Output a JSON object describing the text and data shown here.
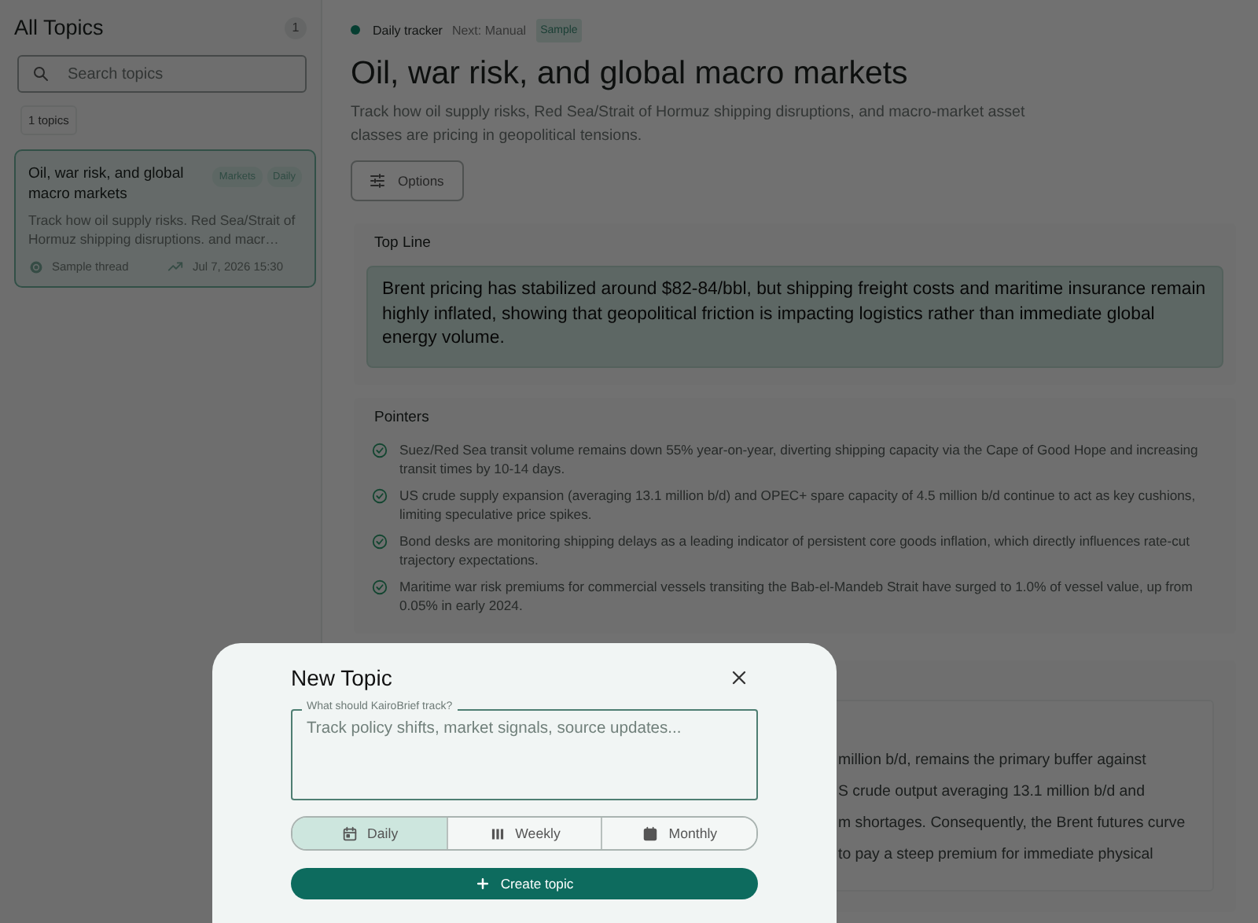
{
  "sidebar": {
    "title": "All Topics",
    "count": "1",
    "search": {
      "placeholder": "Search topics"
    },
    "topics_count": "1 topics",
    "topics": [
      {
        "title": "Oil, war risk, and global macro markets",
        "tags": [
          "Markets",
          "Daily"
        ],
        "description": "Track how oil supply risks. Red Sea/Strait of Hormuz shipping disruptions. and macr…",
        "source": "Sample thread",
        "date": "Jul 7, 2026 15:30",
        "selected": true
      }
    ]
  },
  "header": {
    "tracker": "Daily tracker",
    "next": "Next: Manual",
    "badge": "Sample",
    "title": "Oil, war risk, and global macro markets",
    "description": "Track how oil supply risks, Red Sea/Strait of Hormuz shipping disruptions, and macro-market asset classes are pricing in geopolitical tensions.",
    "options_button": "Options"
  },
  "sections": [
    {
      "kind": "topline",
      "heading": "Top Line",
      "text": "Brent pricing has stabilized around $82-84/bbl, but shipping freight costs and maritime insurance remain highly inflated, showing that geopolitical friction is impacting logistics rather than immediate global energy volume."
    },
    {
      "kind": "pointers",
      "heading": "Pointers",
      "items": [
        "Suez/Red Sea transit volume remains down 55% year-on-year, diverting shipping capacity via the Cape of Good Hope and increasing transit times by 10-14 days.",
        "US crude supply expansion (averaging 13.1 million b/d) and OPEC+ spare capacity of 4.5 million b/d continue to act as key cushions, limiting speculative price spikes.",
        "Bond desks are monitoring shipping delays as a leading indicator of persistent core goods inflation, which directly influences rate-cut trajectory expectations.",
        "Maritime war risk premiums for commercial vessels transiting the Bab-el-Mandeb Strait have surged to 1.0% of vessel value, up from 0.05% in early 2024."
      ]
    },
    {
      "kind": "partial",
      "lines": [
        "million b/d, remains the primary buffer against",
        "S crude output averaging 13.1 million b/d and",
        "m shortages. Consequently, the Brent futures curve",
        "to pay a steep premium for immediate physical"
      ]
    }
  ],
  "modal": {
    "title": "New Topic",
    "field_label": "What should KairoBrief track?",
    "placeholder": "Track policy shifts, market signals, source updates...",
    "frequencies": [
      {
        "kind": "daily",
        "label": "Daily",
        "selected": true
      },
      {
        "kind": "weekly",
        "label": "Weekly",
        "selected": false
      },
      {
        "kind": "monthly",
        "label": "Monthly",
        "selected": false
      }
    ],
    "create_button": "Create topic"
  }
}
